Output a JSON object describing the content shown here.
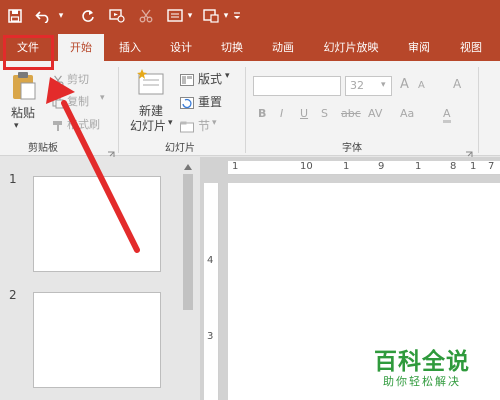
{
  "quick_access": {
    "save_icon": "save-icon",
    "undo_icon": "undo-icon",
    "redo_icon": "redo-icon",
    "dropdown_glyph": "▾"
  },
  "tabs": [
    {
      "label": "文件",
      "active": false
    },
    {
      "label": "开始",
      "active": true
    },
    {
      "label": "插入",
      "active": false
    },
    {
      "label": "设计",
      "active": false
    },
    {
      "label": "切换",
      "active": false
    },
    {
      "label": "动画",
      "active": false
    },
    {
      "label": "幻灯片放映",
      "active": false
    },
    {
      "label": "审阅",
      "active": false
    },
    {
      "label": "视图",
      "active": false
    }
  ],
  "clipboard": {
    "paste": "粘贴",
    "cut": "剪切",
    "copy": "复制",
    "format_painter": "格式刷",
    "group": "剪贴板"
  },
  "slides": {
    "new_slide_line1": "新建",
    "new_slide_line2": "幻灯片",
    "layout": "版式",
    "reset": "重置",
    "section": "节",
    "group": "幻灯片"
  },
  "font": {
    "size": "32",
    "bold": "B",
    "italic": "I",
    "underline": "U",
    "shadow": "S",
    "strike": "abc",
    "spacing": "AV",
    "case": "Aa",
    "grow": "A",
    "shrink": "A",
    "clear": "A",
    "color": "A",
    "group": "字体"
  },
  "thumbnail_panel": {
    "slide_numbers": [
      "1",
      "2"
    ]
  },
  "ruler": {
    "horizontal": [
      "1",
      "10",
      "1",
      "9",
      "1",
      "8",
      "1",
      "7"
    ],
    "vertical": [
      "4",
      "3"
    ]
  },
  "watermark": {
    "title": "百科全说",
    "subtitle": "助你轻松解决"
  },
  "colors": {
    "accent": "#b7472a",
    "highlight": "#e32b2b",
    "watermark": "#2f9a3c"
  }
}
